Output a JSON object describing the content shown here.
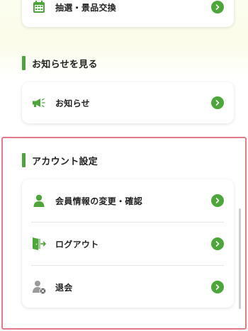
{
  "lottery": {
    "label": "抽選・景品交換",
    "icon": "calendar-icon"
  },
  "news_section": {
    "title": "お知らせを見る",
    "items": [
      {
        "label": "お知らせ",
        "icon": "megaphone-icon"
      }
    ]
  },
  "account_section": {
    "title": "アカウント設定",
    "items": [
      {
        "label": "会員情報の変更・確認",
        "icon": "user-icon"
      },
      {
        "label": "ログアウト",
        "icon": "logout-icon"
      },
      {
        "label": "退会",
        "icon": "user-remove-icon"
      }
    ]
  },
  "colors": {
    "accent": "#4da63a",
    "highlight_border": "#e07a86"
  }
}
